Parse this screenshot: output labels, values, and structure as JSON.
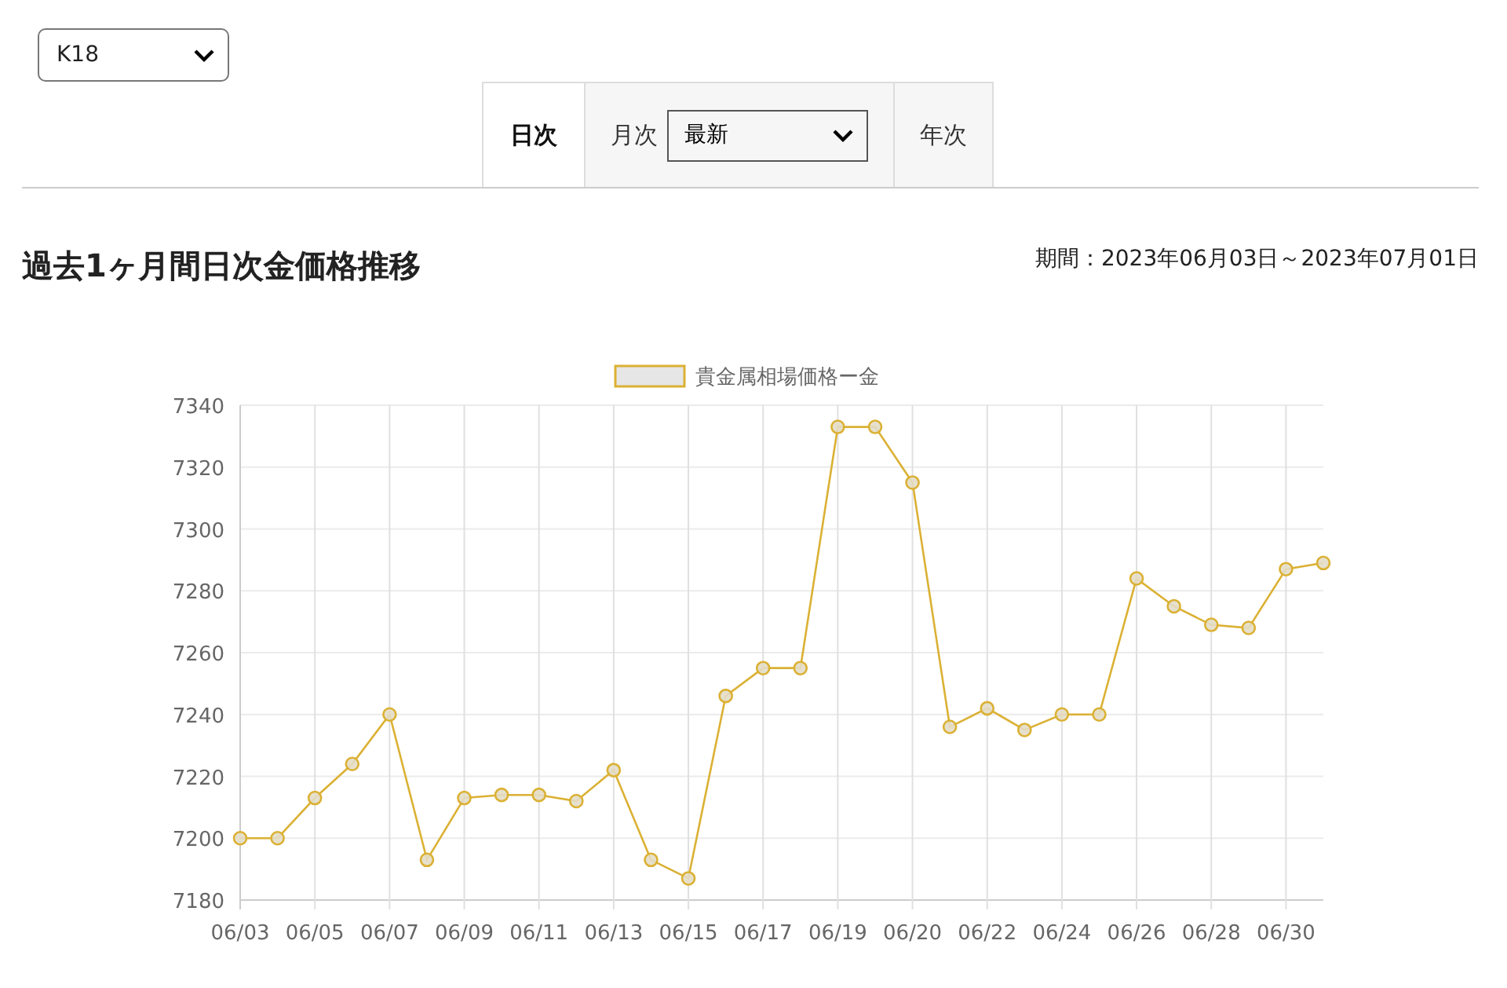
{
  "metal_select": {
    "value": "K18"
  },
  "tabs": [
    {
      "label": "日次",
      "selected": true
    },
    {
      "label": "月次",
      "selected": false,
      "select_value": "最新"
    },
    {
      "label": "年次",
      "selected": false
    }
  ],
  "title": "過去1ヶ月間日次金価格推移",
  "period": "期間：2023年06月03日～2023年07月01日",
  "chart_data": {
    "type": "line",
    "categories": [
      "06/03",
      null,
      "06/05",
      null,
      "06/07",
      null,
      "06/09",
      null,
      "06/11",
      null,
      "06/13",
      null,
      "06/15",
      null,
      "06/17",
      null,
      "06/19",
      null,
      "06/20",
      null,
      "06/22",
      null,
      "06/24",
      null,
      "06/26",
      null,
      "06/28",
      null,
      "06/30",
      null
    ],
    "grid": true,
    "series": [
      {
        "name": "貴金属相場価格ー金",
        "color": "#dbb134",
        "marker": "circle",
        "values": [
          7200,
          7200,
          7213,
          7224,
          7240,
          7193,
          7213,
          7214,
          7214,
          7212,
          7222,
          7193,
          7187,
          7246,
          7255,
          7255,
          7333,
          7333,
          7315,
          7236,
          7242,
          7235,
          7240,
          7240,
          7284,
          7275,
          7269,
          7268,
          7287,
          7289
        ]
      }
    ],
    "ylim": [
      7180,
      7340
    ],
    "yticks": [
      7180,
      7200,
      7220,
      7240,
      7260,
      7280,
      7300,
      7320,
      7340
    ]
  }
}
